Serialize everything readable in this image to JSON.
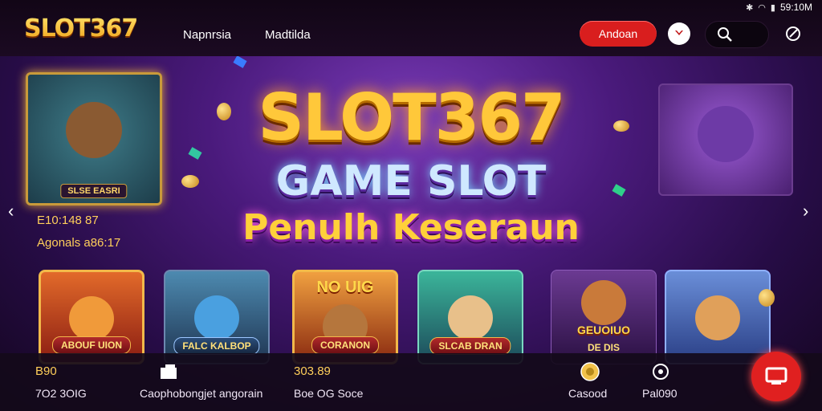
{
  "status_bar": {
    "time": "59:10M",
    "icons": [
      "bluetooth-icon",
      "wifi-icon",
      "signal-icon"
    ]
  },
  "header": {
    "logo": "SLOT367",
    "nav": [
      "Napnrsia",
      "Madtilda"
    ],
    "action_button": "Andoan",
    "accent": "#d91e1e"
  },
  "hero": {
    "title_line1": "SLOT367",
    "title_line2": "GAME SLOT",
    "title_line3": "Penulh Keseraun",
    "feature_left_tag": "SLSE EASRI",
    "stat1": "E10:148 87",
    "stat2": "Agonals a86:17"
  },
  "tiles": [
    {
      "tag": "ABOUF UION",
      "bg": "#c03a1a"
    },
    {
      "tag": "FALC KALBOP",
      "bg": "#2c6a8e"
    },
    {
      "tag": "CORANON",
      "bg": "#d46a1a",
      "sign": "NO UIG"
    },
    {
      "tag": "SLCAB DRAN",
      "bg": "#2aa07a"
    },
    {
      "tag": "DE DIS",
      "bg": "#5a2a7a",
      "sign": "GEUOIUO"
    },
    {
      "tag": "",
      "bg": "#3b5aa8"
    }
  ],
  "bottom_bar": {
    "left_number": "B90",
    "left_label": "7O2 3OIG",
    "center_label": "Caophobongjet angorain",
    "center_number": "303.89",
    "center_sub": "Boe OG Soce",
    "right_item1": "Casood",
    "right_item2": "Pal090"
  }
}
